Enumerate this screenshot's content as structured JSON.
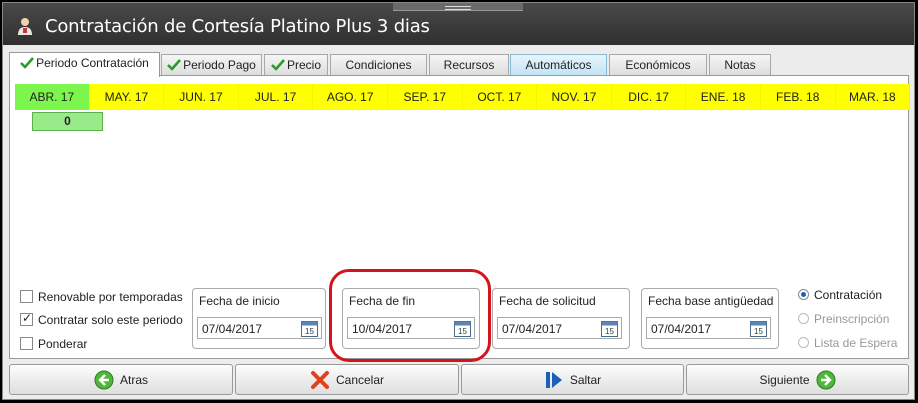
{
  "window": {
    "title": "Contratación de Cortesía Platino Plus 3 dias"
  },
  "tabs": [
    {
      "label": "Periodo Contratación",
      "checked": true
    },
    {
      "label": "Periodo Pago",
      "checked": true
    },
    {
      "label": "Precio",
      "checked": true
    },
    {
      "label": "Condiciones",
      "checked": false
    },
    {
      "label": "Recursos",
      "checked": false
    },
    {
      "label": "Automáticos",
      "checked": false
    },
    {
      "label": "Económicos",
      "checked": false
    },
    {
      "label": "Notas",
      "checked": false
    }
  ],
  "months": [
    "ABR. 17",
    "MAY. 17",
    "JUN. 17",
    "JUL. 17",
    "AGO. 17",
    "SEP. 17",
    "OCT. 17",
    "NOV. 17",
    "DIC. 17",
    "ENE. 18",
    "FEB. 18",
    "MAR. 18"
  ],
  "selected_month_count": "0",
  "options": {
    "renovable": {
      "label": "Renovable por temporadas",
      "checked": false
    },
    "solo_periodo": {
      "label": "Contratar solo este periodo",
      "checked": true
    },
    "ponderar": {
      "label": "Ponderar",
      "checked": false
    }
  },
  "dates": {
    "inicio": {
      "label": "Fecha de inicio",
      "value": "07/04/2017"
    },
    "fin": {
      "label": "Fecha de fin",
      "value": "10/04/2017"
    },
    "solicitud": {
      "label": "Fecha de solicitud",
      "value": "07/04/2017"
    },
    "antiguedad": {
      "label": "Fecha base antigüedad",
      "value": "07/04/2017"
    }
  },
  "calendar_icon_day": "15",
  "mode": {
    "contratacion": {
      "label": "Contratación",
      "selected": true
    },
    "preinscripcion": {
      "label": "Preinscripción",
      "selected": false
    },
    "espera": {
      "label": "Lista de Espera",
      "selected": false
    }
  },
  "buttons": {
    "back": "Atras",
    "cancel": "Cancelar",
    "skip": "Saltar",
    "next": "Siguiente"
  },
  "colors": {
    "month_bg": "#ffff00",
    "current_month_bg": "#7cf64c",
    "highlight": "#d4141c",
    "automaticos_tab": "#bfe3f4"
  }
}
